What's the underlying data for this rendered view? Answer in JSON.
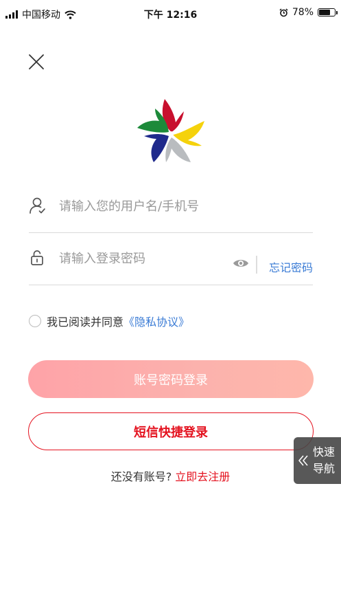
{
  "status_bar": {
    "carrier": "中国移动",
    "time": "下午 12:16",
    "battery_percent": "78%",
    "battery_level": 0.78,
    "icons": [
      "signal-icon",
      "wifi-icon",
      "alarm-icon",
      "battery-icon"
    ]
  },
  "header": {
    "close_icon": "close-icon"
  },
  "logo": {
    "icon": "pinwheel-logo",
    "colors": [
      "#c8102e",
      "#f5d20c",
      "#b9bcbf",
      "#1f2a8c",
      "#1d8a3a"
    ]
  },
  "form": {
    "username": {
      "placeholder": "请输入您的用户名/手机号",
      "value": "",
      "icon": "user-icon"
    },
    "password": {
      "placeholder": "请输入登录密码",
      "value": "",
      "icon": "lock-icon",
      "eye_icon": "eye-icon",
      "forgot_label": "忘记密码"
    },
    "agreement": {
      "prefix": "我已阅读并同意",
      "link": "《隐私协议》",
      "checked": false
    }
  },
  "buttons": {
    "login": "账号密码登录",
    "sms_login": "短信快捷登录"
  },
  "register": {
    "prompt": "还没有账号?",
    "link": "立即去注册"
  },
  "quick_nav": {
    "line1": "快速",
    "line2": "导航",
    "icon": "double-chevron-left-icon"
  },
  "colors": {
    "accent_red": "#e4121f",
    "link_blue": "#3a7bd5",
    "login_gradient_start": "#fea3a8",
    "login_gradient_end": "#feb7ab"
  }
}
